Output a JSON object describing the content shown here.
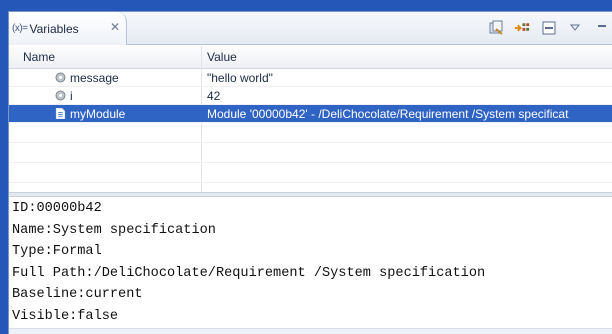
{
  "view": {
    "tab_icon_text": "(x)=",
    "tab_label": "Variables",
    "tab_close": "✕"
  },
  "toolbar": {
    "icons": [
      "collapse-all-icon",
      "show-types-icon",
      "minimize-icon",
      "view-menu-icon",
      "maximize-icon"
    ]
  },
  "table": {
    "columns": [
      "Name",
      "Value"
    ],
    "rows": [
      {
        "name": "message",
        "value": "\"hello world\"",
        "icon": "field-icon"
      },
      {
        "name": "i",
        "value": "42",
        "icon": "field-icon"
      },
      {
        "name": "myModule",
        "value": "Module '00000b42' - /DeliChocolate/Requirement /System specificat",
        "icon": "module-icon",
        "selected": true
      }
    ]
  },
  "details": [
    "ID:00000b42",
    "Name:System specification",
    "Type:Formal",
    "Full Path:/DeliChocolate/Requirement /System specification",
    "Baseline:current",
    "Visible:false"
  ],
  "colors": {
    "selection": "#2f63c4",
    "frame": "#2457b7"
  }
}
